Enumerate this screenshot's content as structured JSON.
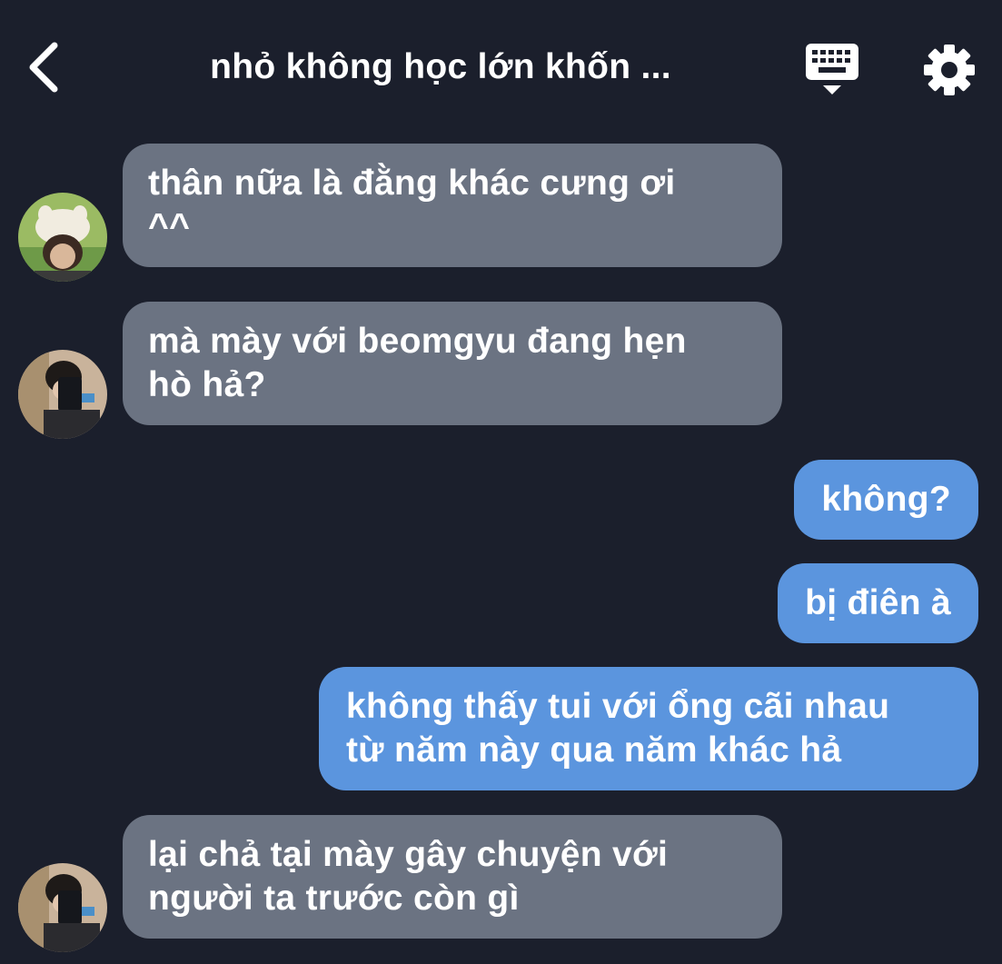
{
  "header": {
    "title": "nhỏ không học lớn khốn ...",
    "back_icon": "chevron-left-icon",
    "keyboard_icon": "keyboard-icon",
    "settings_icon": "gear-icon"
  },
  "colors": {
    "background": "#1b1f2c",
    "incoming_bubble": "#6b7382",
    "outgoing_bubble": "#5b95de",
    "text": "#ffffff"
  },
  "messages": [
    {
      "direction": "incoming",
      "avatar": "avatar-hat-user",
      "text": "thân nữa là đằng khác cưng ơi\n^^"
    },
    {
      "direction": "incoming",
      "avatar": "avatar-mirror-user",
      "text": "mà mày với beomgyu đang hẹn\nhò hả?"
    },
    {
      "direction": "outgoing",
      "text": "không?"
    },
    {
      "direction": "outgoing",
      "text": "bị điên à"
    },
    {
      "direction": "outgoing",
      "text": "không thấy tui với ổng cãi nhau\ntừ năm này qua năm khác hả"
    },
    {
      "direction": "incoming",
      "avatar": "avatar-mirror-user",
      "text": "lại chả tại mày gây chuyện với\nngười ta trước còn gì"
    }
  ]
}
